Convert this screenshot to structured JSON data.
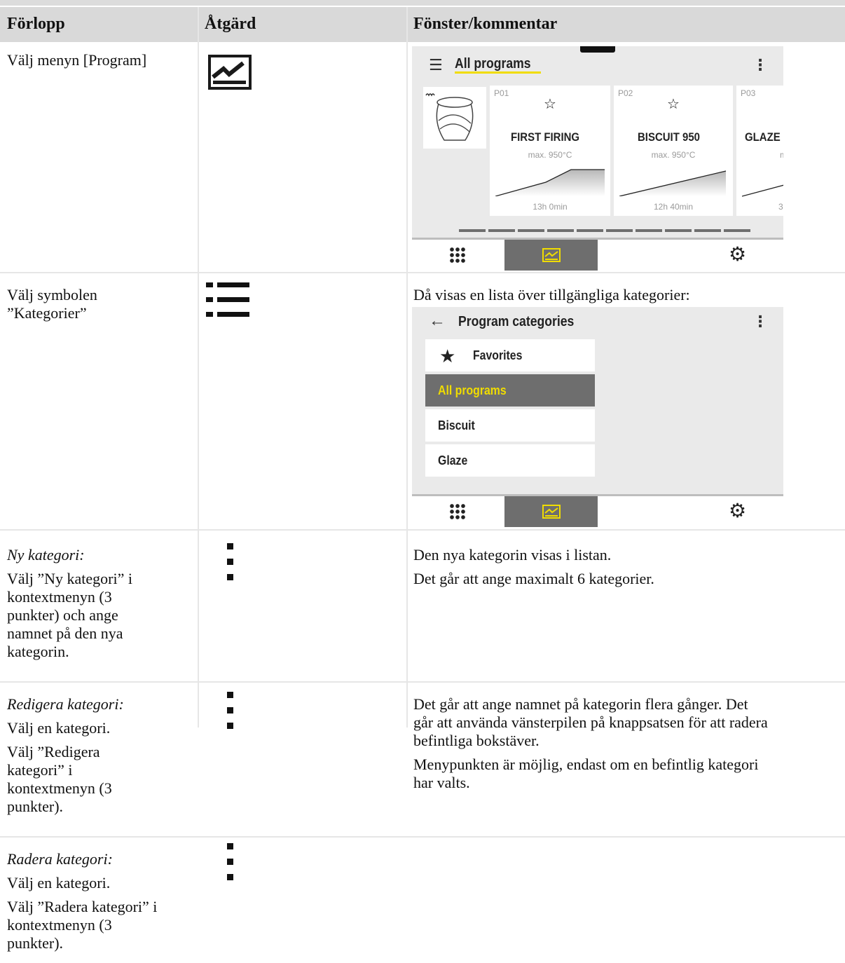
{
  "headers": {
    "col1": "Förlopp",
    "col2": "Åtgärd",
    "col3": "Fönster/kommentar"
  },
  "rows": [
    {
      "step": "Välj menyn [Program]"
    },
    {
      "step_lines": [
        "Välj symbolen",
        "”Kategorier”"
      ],
      "comment": "Då visas en lista över tillgängliga kategorier:"
    },
    {
      "title": "Ny kategori:",
      "step_lines": [
        "Välj ”Ny kategori” i",
        "kontextmenyn (3",
        "punkter) och ange",
        "namnet på den nya",
        "kategorin."
      ],
      "comment_lines": [
        "Den nya kategorin visas i listan.",
        "Det går att ange maximalt 6 kategorier."
      ]
    },
    {
      "title": "Redigera kategori:",
      "step1": "Välj en kategori.",
      "step_lines": [
        "Välj ”Redigera",
        "kategori” i",
        "kontextmenyn (3",
        "punkter)."
      ],
      "comment1_lines": [
        "Det går att ange namnet på kategorin flera gånger. Det",
        "går att använda vänsterpilen på knappsatsen för att radera",
        "befintliga bokstäver."
      ],
      "comment2_lines": [
        "Menypunkten är möjlig, endast om en befintlig kategori",
        "har valts."
      ]
    },
    {
      "title": "Radera kategori:",
      "step1": "Välj en kategori.",
      "step_lines": [
        "Välj ”Radera kategori” i",
        "kontextmenyn (3",
        "punkter)."
      ]
    }
  ],
  "screen1": {
    "title": "All programs",
    "programs": [
      {
        "num": "P01",
        "name": "FIRST FIRING",
        "max": "max. 950°C",
        "duration": "13h 0min"
      },
      {
        "num": "P02",
        "name": "BISCUIT 950",
        "max": "max. 950°C",
        "duration": "12h 40min"
      },
      {
        "num": "P03",
        "name": "GLAZE",
        "max": "m",
        "duration": "3"
      }
    ]
  },
  "screen2": {
    "title": "Program categories",
    "categories": [
      "Favorites",
      "All programs",
      "Biscuit",
      "Glaze"
    ]
  },
  "colors": {
    "accent": "#f0dc00",
    "selected_bg": "#6e6e6e",
    "header_bg": "#d9d9d9"
  }
}
